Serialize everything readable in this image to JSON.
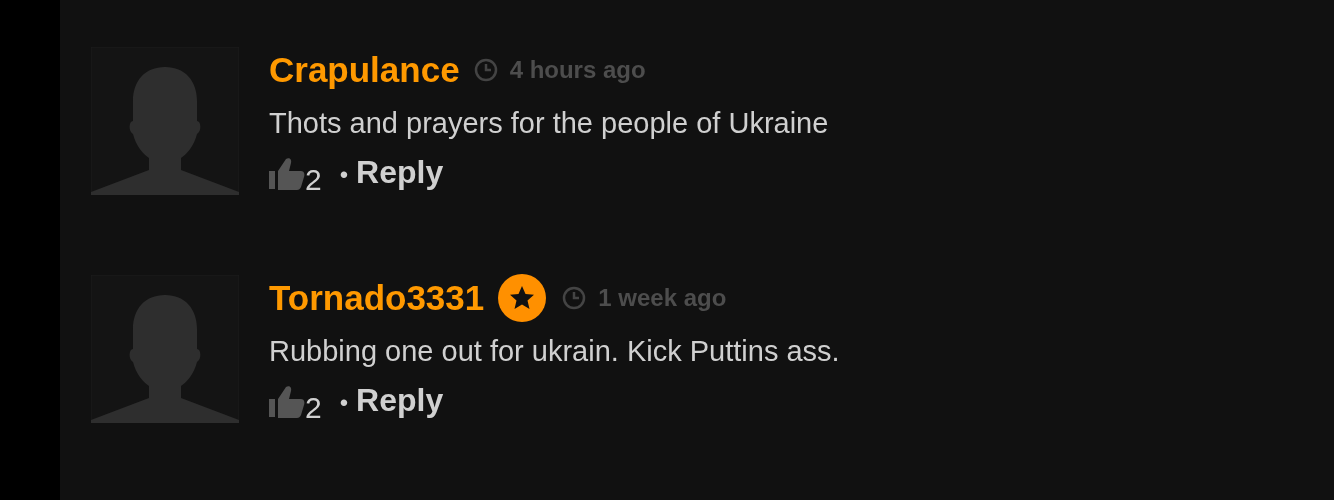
{
  "comments": [
    {
      "author": "Crapulance",
      "badge": false,
      "time": "4 hours ago",
      "text": "Thots and prayers for the people of Ukraine",
      "likes": "2",
      "separator": "•",
      "reply": "Reply"
    },
    {
      "author": "Tornado3331",
      "badge": true,
      "time": "1 week ago",
      "text": "Rubbing one out for ukrain. Kick Puttins ass.",
      "likes": "2",
      "separator": "•",
      "reply": "Reply"
    }
  ]
}
